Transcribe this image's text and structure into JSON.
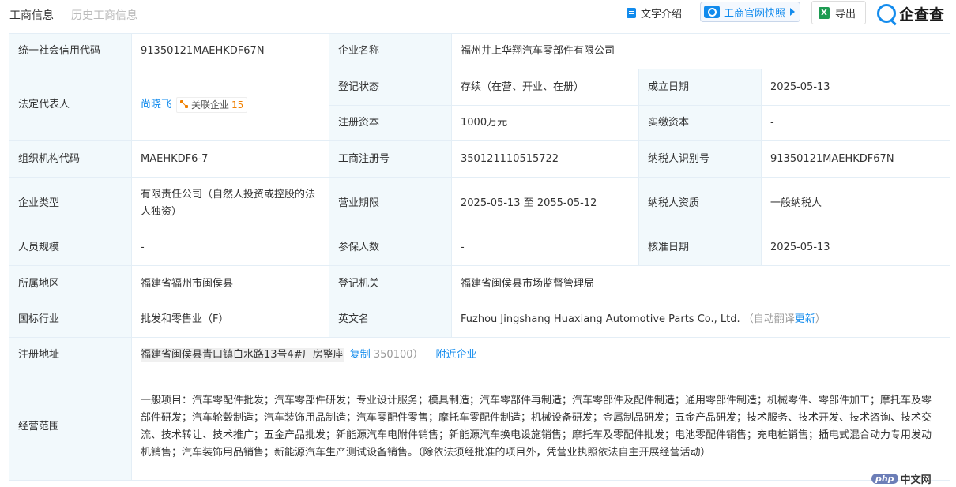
{
  "tabs": [
    {
      "label": "工商信息"
    },
    {
      "label": "历史工商信息"
    }
  ],
  "toolbar": {
    "text_intro": "文字介绍",
    "snapshot": "工商官网快照",
    "export": "导出",
    "logo": "企查查",
    "excel_glyph": "X"
  },
  "colors": {
    "accent": "#128bed",
    "label_bg": "#f2f9fc",
    "border": "#e4eef6",
    "badge_count": "#f08000"
  },
  "info": {
    "credit_code": {
      "label": "统一社会信用代码",
      "value": "91350121MAEHKDF67N"
    },
    "company_name": {
      "label": "企业名称",
      "value": "福州井上华翔汽车零部件有限公司"
    },
    "legal_rep": {
      "label": "法定代表人",
      "value": "尚晓飞",
      "badge_label": "关联企业",
      "badge_count": "15"
    },
    "reg_status": {
      "label": "登记状态",
      "value": "存续（在营、开业、在册）"
    },
    "found_date": {
      "label": "成立日期",
      "value": "2025-05-13"
    },
    "reg_capital": {
      "label": "注册资本",
      "value": "1000万元"
    },
    "paid_capital": {
      "label": "实缴资本",
      "value": "-"
    },
    "org_code": {
      "label": "组织机构代码",
      "value": "MAEHKDF6-7"
    },
    "biz_reg_no": {
      "label": "工商注册号",
      "value": "350121110515722"
    },
    "taxpayer_id": {
      "label": "纳税人识别号",
      "value": "91350121MAEHKDF67N"
    },
    "company_type": {
      "label": "企业类型",
      "value": "有限责任公司（自然人投资或控股的法人独资）"
    },
    "biz_term": {
      "label": "营业期限",
      "value": "2025-05-13 至 2055-05-12"
    },
    "taxpayer_qual": {
      "label": "纳税人资质",
      "value": "一般纳税人"
    },
    "staff_size": {
      "label": "人员规模",
      "value": "-"
    },
    "insured": {
      "label": "参保人数",
      "value": "-"
    },
    "approve_date": {
      "label": "核准日期",
      "value": "2025-05-13"
    },
    "region": {
      "label": "所属地区",
      "value": "福建省福州市闽侯县"
    },
    "reg_authority": {
      "label": "登记机关",
      "value": "福建省闽侯县市场监督管理局"
    },
    "industry": {
      "label": "国标行业",
      "value": "批发和零售业（F）"
    },
    "english_name": {
      "label": "英文名",
      "value": "Fuzhou Jingshang Huaxiang Automotive Parts Co., Ltd.",
      "hint_open": "（自动翻译",
      "update": "更新",
      "hint_close": "）"
    },
    "address": {
      "label": "注册地址",
      "value": "福建省闽侯县青口镇白水路13号4#厂房整座",
      "copy": "复制",
      "postcode": "350100）",
      "nearby": "附近企业"
    },
    "scope": {
      "label": "经营范围",
      "value": "一般项目：汽车零配件批发；汽车零部件研发；专业设计服务；模具制造；汽车零部件再制造；汽车零部件及配件制造；通用零部件制造；机械零件、零部件加工；摩托车及零部件研发；汽车轮毂制造；汽车装饰用品制造；汽车零配件零售；摩托车零配件制造；机械设备研发；金属制品研发；五金产品研发；技术服务、技术开发、技术咨询、技术交流、技术转让、技术推广；五金产品批发；新能源汽车电附件销售；新能源汽车换电设施销售；摩托车及零配件批发；电池零配件销售；充电桩销售；插电式混合动力专用发动机销售；汽车装饰用品销售；新能源汽车生产测试设备销售。（除依法须经批准的项目外，凭营业执照依法自主开展经营活动）"
    }
  },
  "watermark": {
    "php": "php",
    "cn": "中文网"
  }
}
